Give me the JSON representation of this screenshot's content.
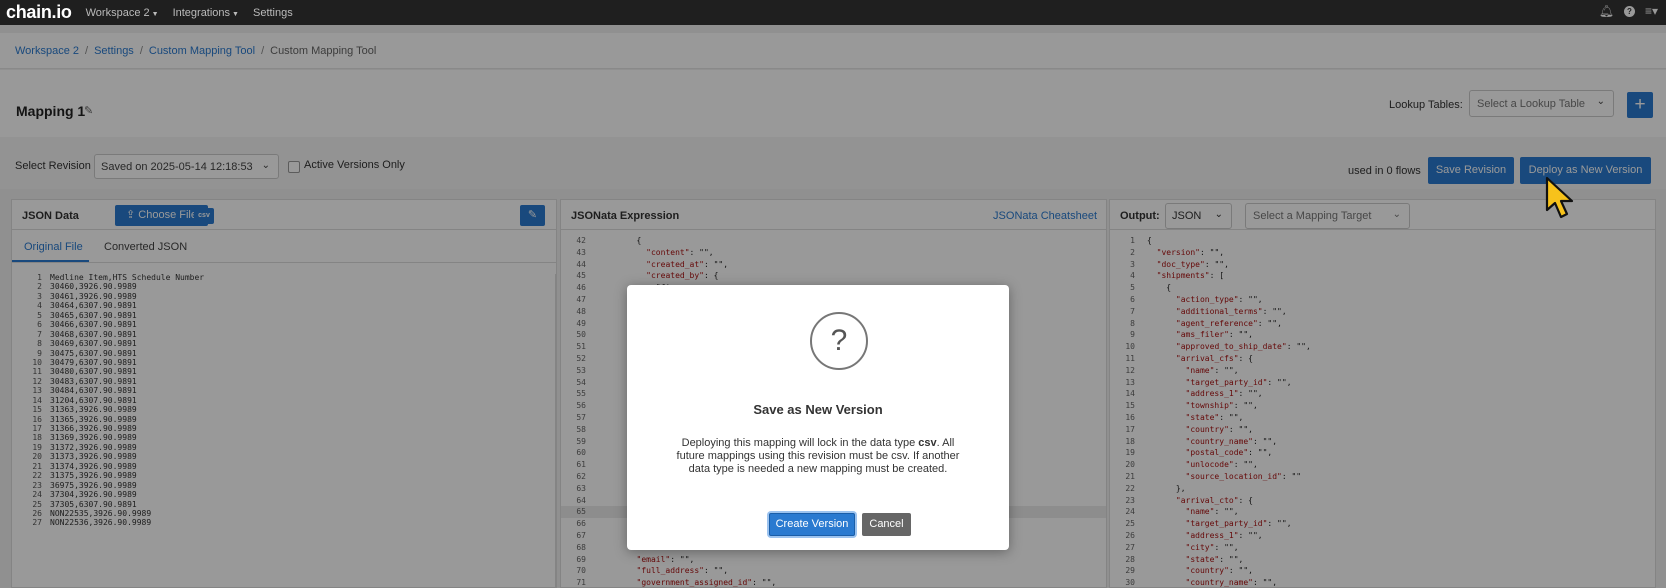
{
  "nav": {
    "logo": "chain.io",
    "items": [
      "Workspace 2",
      "Integrations",
      "Settings"
    ]
  },
  "breadcrumb": [
    "Workspace 2",
    "Settings",
    "Custom Mapping Tool",
    "Custom Mapping Tool"
  ],
  "header": {
    "title": "Mapping 1",
    "lookup_label": "Lookup Tables:",
    "lookup_placeholder": "Select a Lookup Table",
    "plus": "+"
  },
  "revision": {
    "label": "Select Revision",
    "selected": "Saved on 2025-05-14 12:18:53",
    "active_only_label": "Active Versions Only",
    "flows": "used in 0 flows",
    "save_label": "Save Revision",
    "deploy_label": "Deploy as New Version"
  },
  "json_panel": {
    "title": "JSON Data",
    "choose_file": "Choose File",
    "tag": "csv",
    "tabs": [
      "Original File",
      "Converted JSON"
    ],
    "lines": [
      "Medline Item,HTS Schedule Number",
      "30460,3926.90.9989",
      "30461,3926.90.9989",
      "30464,6307.90.9891",
      "30465,6307.90.9891",
      "30466,6307.90.9891",
      "30468,6307.90.9891",
      "30469,6307.90.9891",
      "30475,6307.90.9891",
      "30479,6307.90.9891",
      "30480,6307.90.9891",
      "30483,6307.90.9891",
      "30484,6307.90.9891",
      "31204,6307.90.9891",
      "31363,3926.90.9989",
      "31365,3926.90.9989",
      "31366,3926.90.9989",
      "31369,3926.90.9989",
      "31372,3926.90.9989",
      "31373,3926.90.9989",
      "31374,3926.90.9989",
      "31375,3926.90.9989",
      "36975,3926.90.9989",
      "37304,3926.90.9989",
      "37305,6307.90.9891",
      "NON22535,3926.90.9989",
      "NON22536,3926.90.9989"
    ]
  },
  "jsonata_panel": {
    "title": "JSONata Expression",
    "cheatsheet": "JSONata Cheatsheet",
    "lines": [
      {
        "n": "42",
        "t": "        {"
      },
      {
        "n": "43",
        "t": "          \"content\": \"\","
      },
      {
        "n": "44",
        "t": "          \"created_at\": \"\","
      },
      {
        "n": "45",
        "t": "          \"created_by\": {"
      },
      {
        "n": "46",
        "t": "            \"fi"
      },
      {
        "n": "47",
        "t": "            \"l"
      },
      {
        "n": "48",
        "t": "            \"u"
      },
      {
        "n": "49",
        "t": "            \"e"
      },
      {
        "n": "50",
        "t": "          },"
      },
      {
        "n": "51",
        "t": "          \"fil"
      },
      {
        "n": "52",
        "t": "          \"fil"
      },
      {
        "n": "53",
        "t": "          \"fil"
      },
      {
        "n": "54",
        "t": "          \"med"
      },
      {
        "n": "55",
        "t": "          \"mem"
      },
      {
        "n": "56",
        "t": "          \"pri"
      },
      {
        "n": "57",
        "t": "          \"sou"
      },
      {
        "n": "58",
        "t": "        }"
      },
      {
        "n": "59",
        "t": "      ],"
      },
      {
        "n": "60",
        "t": "      \"bill_of_"
      },
      {
        "n": "61",
        "t": "        \"addres"
      },
      {
        "n": "62",
        "t": "        \"addres"
      },
      {
        "n": "63",
        "t": "        \"addres"
      },
      {
        "n": "64",
        "t": "        \"addres"
      },
      {
        "n": "65",
        "t": "        \"addres"
      },
      {
        "n": "66",
        "t": "        \"city\""
      },
      {
        "n": "67",
        "t": "        \"countr"
      },
      {
        "n": "68",
        "t": "        \"countr"
      },
      {
        "n": "69",
        "t": "        \"email\": \"\","
      },
      {
        "n": "70",
        "t": "        \"full_address\": \"\","
      },
      {
        "n": "71",
        "t": "        \"government_assigned_id\": \"\","
      }
    ]
  },
  "output_panel": {
    "title": "Output:",
    "format": "JSON",
    "target_placeholder": "Select a Mapping Target",
    "lines": [
      {
        "n": "1",
        "t": "{"
      },
      {
        "n": "2",
        "t": "  \"version\": \"\","
      },
      {
        "n": "3",
        "t": "  \"doc_type\": \"\","
      },
      {
        "n": "4",
        "t": "  \"shipments\": ["
      },
      {
        "n": "5",
        "t": "    {"
      },
      {
        "n": "6",
        "t": "      \"action_type\": \"\","
      },
      {
        "n": "7",
        "t": "      \"additional_terms\": \"\","
      },
      {
        "n": "8",
        "t": "      \"agent_reference\": \"\","
      },
      {
        "n": "9",
        "t": "      \"ams_filer\": \"\","
      },
      {
        "n": "10",
        "t": "      \"approved_to_ship_date\": \"\","
      },
      {
        "n": "11",
        "t": "      \"arrival_cfs\": {"
      },
      {
        "n": "12",
        "t": "        \"name\": \"\","
      },
      {
        "n": "13",
        "t": "        \"target_party_id\": \"\","
      },
      {
        "n": "14",
        "t": "        \"address_1\": \"\","
      },
      {
        "n": "15",
        "t": "        \"township\": \"\","
      },
      {
        "n": "16",
        "t": "        \"state\": \"\","
      },
      {
        "n": "17",
        "t": "        \"country\": \"\","
      },
      {
        "n": "18",
        "t": "        \"country_name\": \"\","
      },
      {
        "n": "19",
        "t": "        \"postal_code\": \"\","
      },
      {
        "n": "20",
        "t": "        \"unlocode\": \"\","
      },
      {
        "n": "21",
        "t": "        \"source_location_id\": \"\""
      },
      {
        "n": "22",
        "t": "      },"
      },
      {
        "n": "23",
        "t": "      \"arrival_cto\": {"
      },
      {
        "n": "24",
        "t": "        \"name\": \"\","
      },
      {
        "n": "25",
        "t": "        \"target_party_id\": \"\","
      },
      {
        "n": "26",
        "t": "        \"address_1\": \"\","
      },
      {
        "n": "27",
        "t": "        \"city\": \"\","
      },
      {
        "n": "28",
        "t": "        \"state\": \"\","
      },
      {
        "n": "29",
        "t": "        \"country\": \"\","
      },
      {
        "n": "30",
        "t": "        \"country_name\": \"\","
      }
    ]
  },
  "modal": {
    "icon": "?",
    "title": "Save as New Version",
    "body_1": "Deploying this mapping will lock in the data type",
    "body_bold": "csv",
    "body_2": ". All future mappings using this revision must be csv. If another data type is needed a new mapping must be created.",
    "create_label": "Create Version",
    "cancel_label": "Cancel"
  },
  "colors": {
    "accent": "#2a7ad0",
    "nav_bg": "#1f1f1f",
    "string": "#a11111"
  }
}
